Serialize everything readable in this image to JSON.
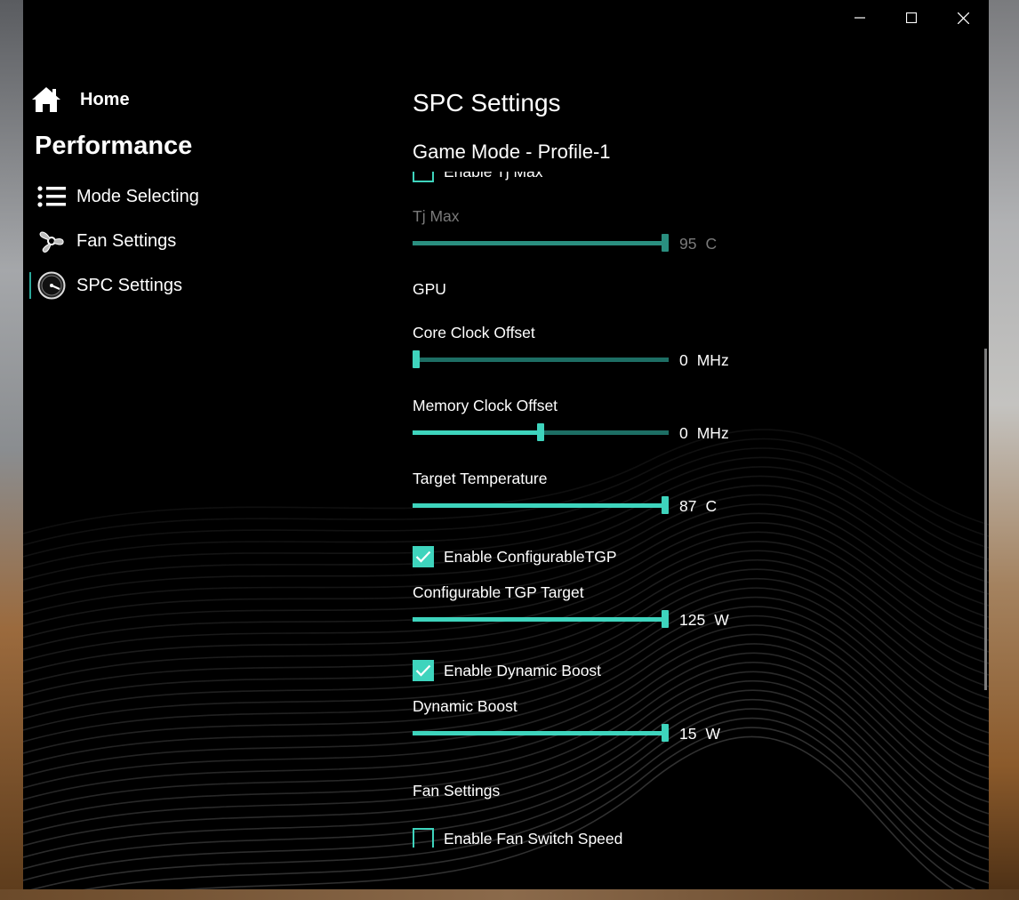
{
  "window": {
    "controls": [
      "minimize",
      "maximize",
      "close"
    ]
  },
  "sidebar": {
    "home_label": "Home",
    "section_title": "Performance",
    "items": [
      {
        "label": "Mode Selecting",
        "icon": "list-icon"
      },
      {
        "label": "Fan Settings",
        "icon": "fan-icon"
      },
      {
        "label": "SPC Settings",
        "icon": "gauge-icon",
        "selected": true
      }
    ]
  },
  "main": {
    "title": "SPC Settings",
    "profile": "Game Mode - Profile-1",
    "enable_tj_max": {
      "label": "Enable Tj Max",
      "checked": false
    },
    "tj_max": {
      "label": "Tj Max",
      "value": "95",
      "unit": "C",
      "fraction": 1.0,
      "enabled": false
    },
    "gpu_header": "GPU",
    "core_clock": {
      "label": "Core Clock Offset",
      "value": "0",
      "unit": "MHz",
      "fraction": 0.0
    },
    "memory_clock": {
      "label": "Memory Clock Offset",
      "value": "0",
      "unit": "MHz",
      "fraction": 0.5
    },
    "target_temp": {
      "label": "Target Temperature",
      "value": "87",
      "unit": "C",
      "fraction": 1.0
    },
    "enable_tgp": {
      "label": "Enable ConfigurableTGP",
      "checked": true
    },
    "tgp_target": {
      "label": "Configurable TGP Target",
      "value": "125",
      "unit": "W",
      "fraction": 1.0
    },
    "enable_boost": {
      "label": "Enable Dynamic Boost",
      "checked": true
    },
    "dynamic_boost": {
      "label": "Dynamic Boost",
      "value": "15",
      "unit": "W",
      "fraction": 1.0
    },
    "fan_header": "Fan Settings",
    "enable_fan_switch": {
      "label": "Enable Fan Switch Speed",
      "checked": false
    }
  },
  "colors": {
    "accent": "#3ed4bd",
    "track": "#1d6e64",
    "background": "#000000"
  }
}
